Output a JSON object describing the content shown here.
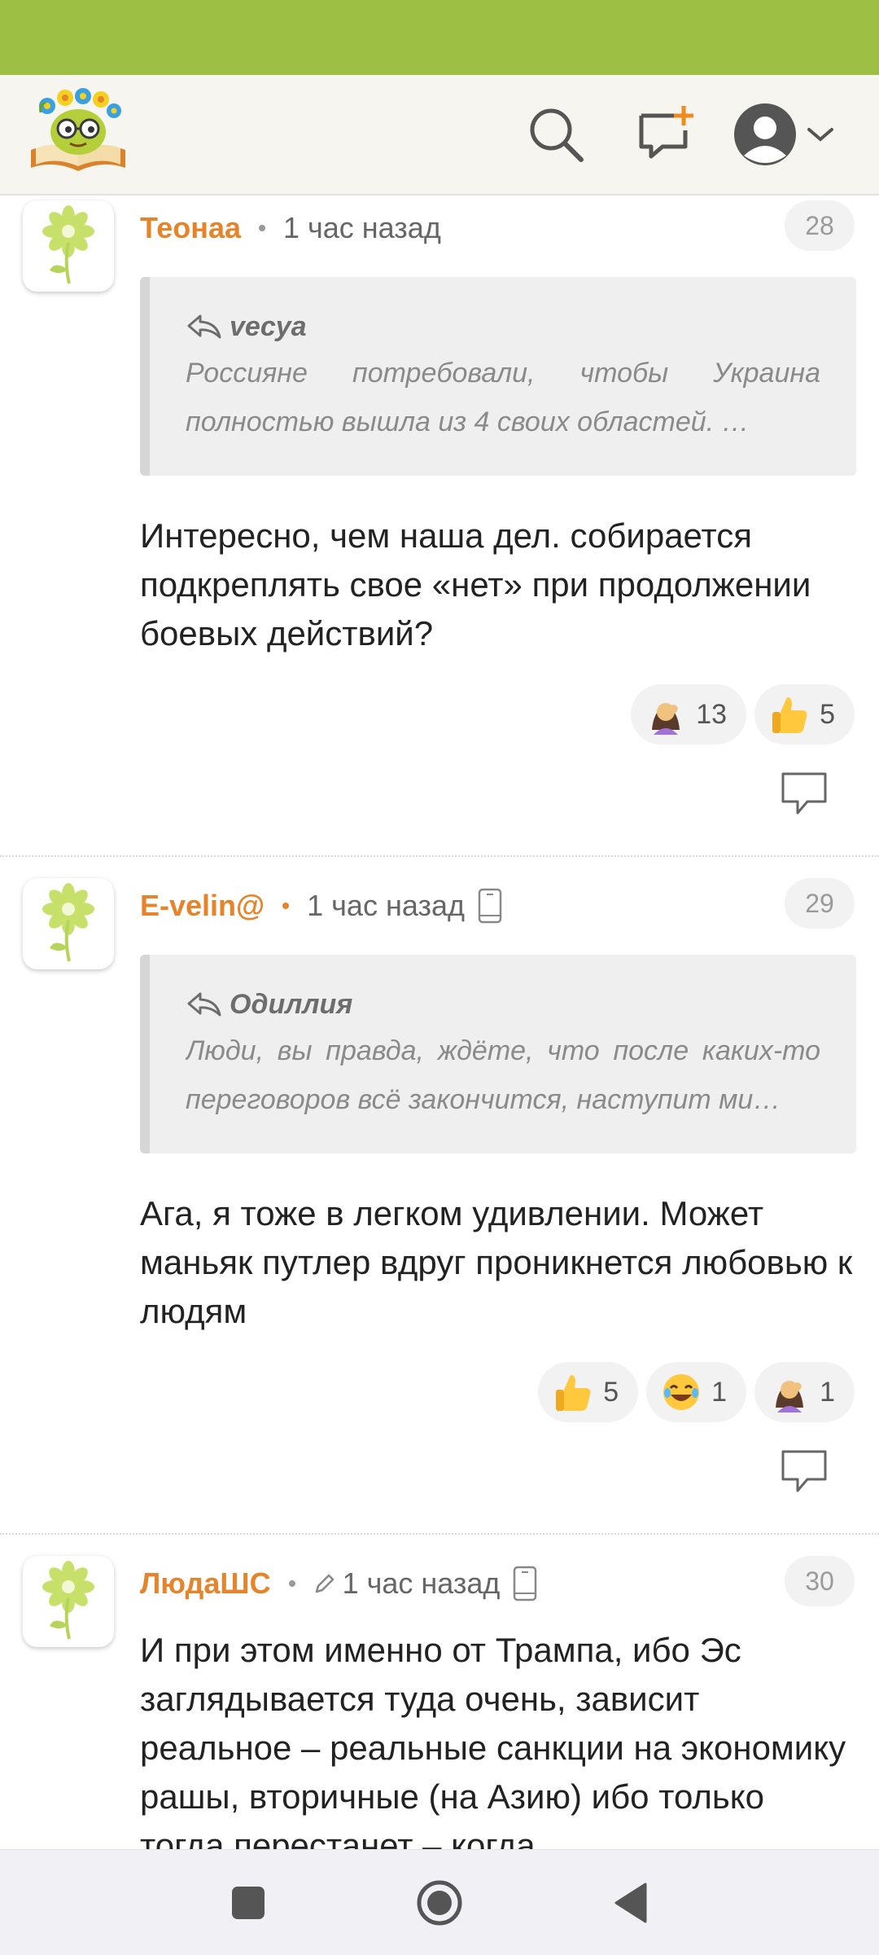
{
  "colors": {
    "status_bar": "#9dc044",
    "accent": "#e5842a",
    "appbar_bg": "#f6f5f0"
  },
  "header": {
    "logo": "site-logo",
    "icons": [
      "search-icon",
      "new-topic-icon",
      "user-avatar-icon",
      "chevron-down-icon"
    ]
  },
  "comments": [
    {
      "author": "Теонаа",
      "time": "1 час назад",
      "number": "28",
      "quote": {
        "author": "vecya",
        "text": "Россияне потребовали, чтобы Украина полностью вышла из 4 своих областей. …"
      },
      "text": "Интересно, чем наша дел. собирается подкреплять свое «нет» при продолжении боевых действий?",
      "reactions": [
        {
          "emoji": "facepalm",
          "count": "13"
        },
        {
          "emoji": "thumbs-up",
          "count": "5"
        }
      ]
    },
    {
      "author": "E-velin@",
      "time": "1 час назад",
      "number": "29",
      "quote": {
        "author": "Одиллия",
        "text": "Люди, вы правда, ждёте, что после каких-то переговоров всё закончится, наступит ми…"
      },
      "text": "Ага, я тоже в легком удивлении. Может маньяк путлер вдруг проникнется любовью к людям",
      "reactions": [
        {
          "emoji": "thumbs-up",
          "count": "5"
        },
        {
          "emoji": "laughing",
          "count": "1"
        },
        {
          "emoji": "facepalm",
          "count": "1"
        }
      ]
    },
    {
      "author": "ЛюдаШС",
      "time": "1 час назад",
      "number": "30",
      "text": "И при этом именно от Трампа, ибо Эс заглядывается туда очень, зависит реальное – реальные санкции на экономику рашы, вторичные (на Азию) ибо только тогда перестанет – когда"
    }
  ]
}
